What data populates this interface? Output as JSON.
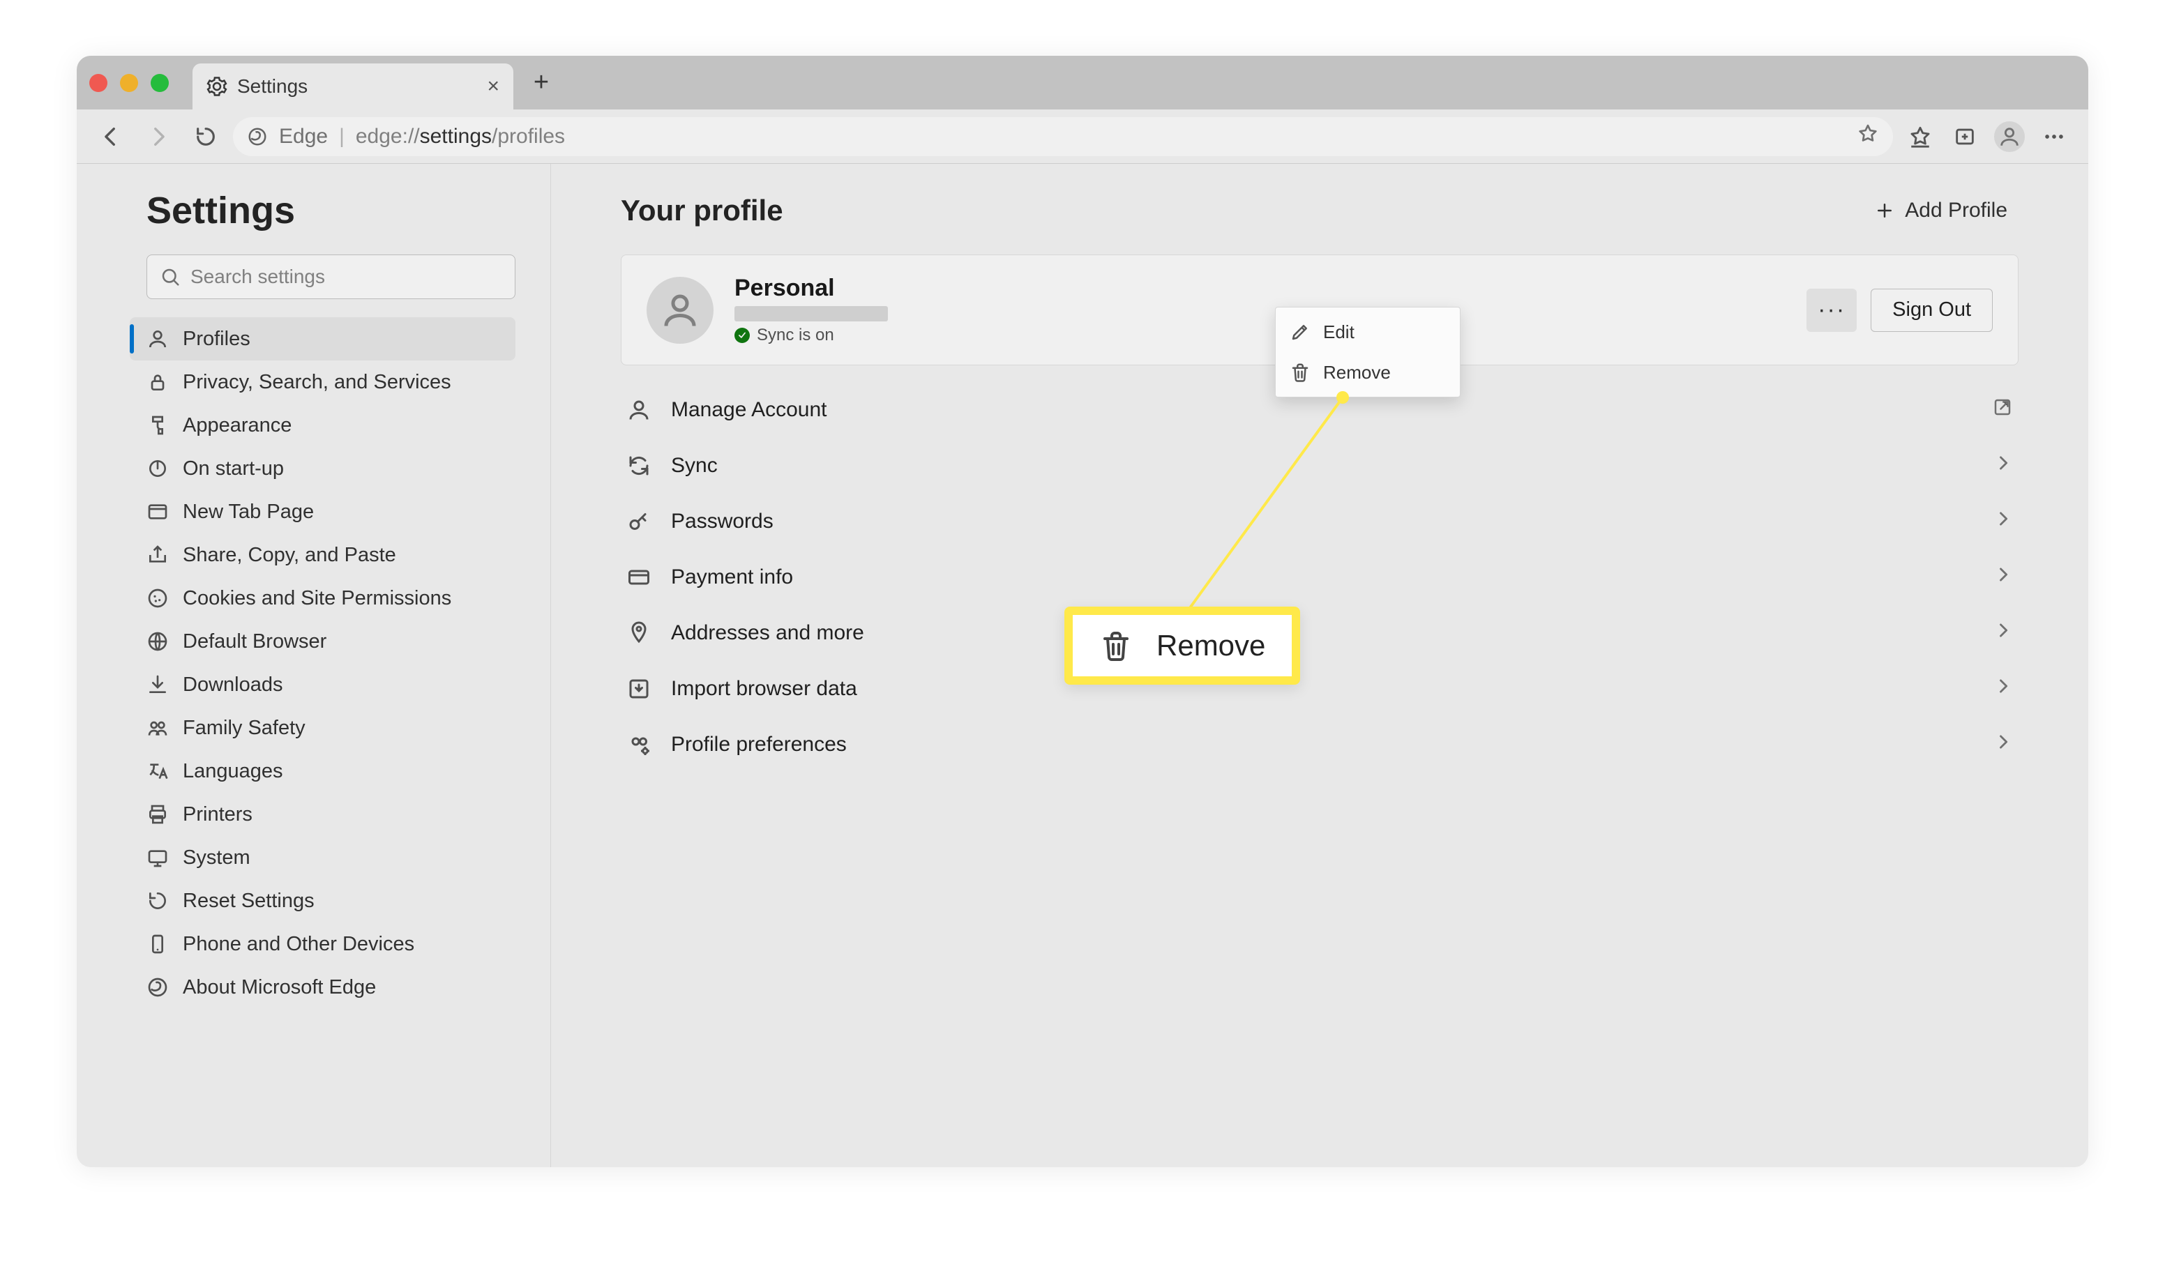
{
  "tab": {
    "title": "Settings"
  },
  "address": {
    "brand": "Edge",
    "url_prefix": "edge://",
    "url_bold": "settings",
    "url_suffix": "/profiles"
  },
  "sidebar": {
    "title": "Settings",
    "search_placeholder": "Search settings",
    "items": [
      {
        "label": "Profiles"
      },
      {
        "label": "Privacy, Search, and Services"
      },
      {
        "label": "Appearance"
      },
      {
        "label": "On start-up"
      },
      {
        "label": "New Tab Page"
      },
      {
        "label": "Share, Copy, and Paste"
      },
      {
        "label": "Cookies and Site Permissions"
      },
      {
        "label": "Default Browser"
      },
      {
        "label": "Downloads"
      },
      {
        "label": "Family Safety"
      },
      {
        "label": "Languages"
      },
      {
        "label": "Printers"
      },
      {
        "label": "System"
      },
      {
        "label": "Reset Settings"
      },
      {
        "label": "Phone and Other Devices"
      },
      {
        "label": "About Microsoft Edge"
      }
    ]
  },
  "main": {
    "heading": "Your profile",
    "add_profile": "Add Profile",
    "profile": {
      "name": "Personal",
      "sync": "Sync is on",
      "signout": "Sign Out"
    },
    "rows": [
      {
        "label": "Manage Account",
        "trailing": "ext"
      },
      {
        "label": "Sync",
        "trailing": "chev"
      },
      {
        "label": "Passwords",
        "trailing": "chev"
      },
      {
        "label": "Payment info",
        "trailing": "chev"
      },
      {
        "label": "Addresses and more",
        "trailing": "chev"
      },
      {
        "label": "Import browser data",
        "trailing": "chev"
      },
      {
        "label": "Profile preferences",
        "trailing": "chev"
      }
    ]
  },
  "ctx": {
    "edit": "Edit",
    "remove": "Remove"
  },
  "callout": {
    "label": "Remove"
  }
}
